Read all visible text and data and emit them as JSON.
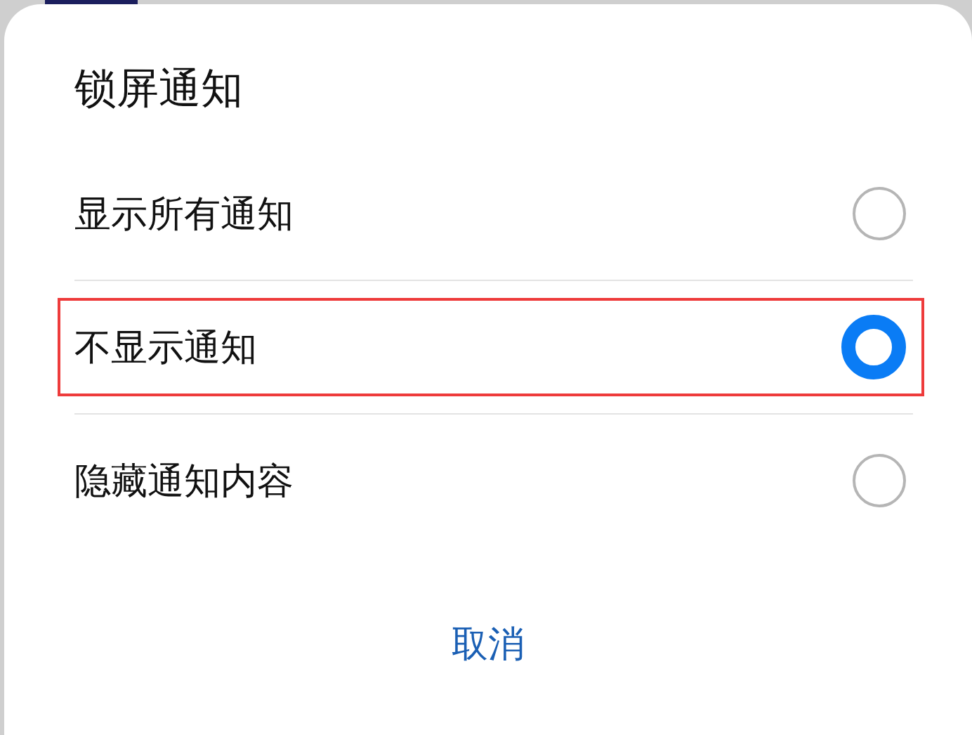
{
  "dialog": {
    "title": "锁屏通知",
    "options": [
      {
        "label": "显示所有通知",
        "selected": false,
        "highlighted": false
      },
      {
        "label": "不显示通知",
        "selected": true,
        "highlighted": true
      },
      {
        "label": "隐藏通知内容",
        "selected": false,
        "highlighted": false
      }
    ],
    "cancel_button": "取消"
  }
}
